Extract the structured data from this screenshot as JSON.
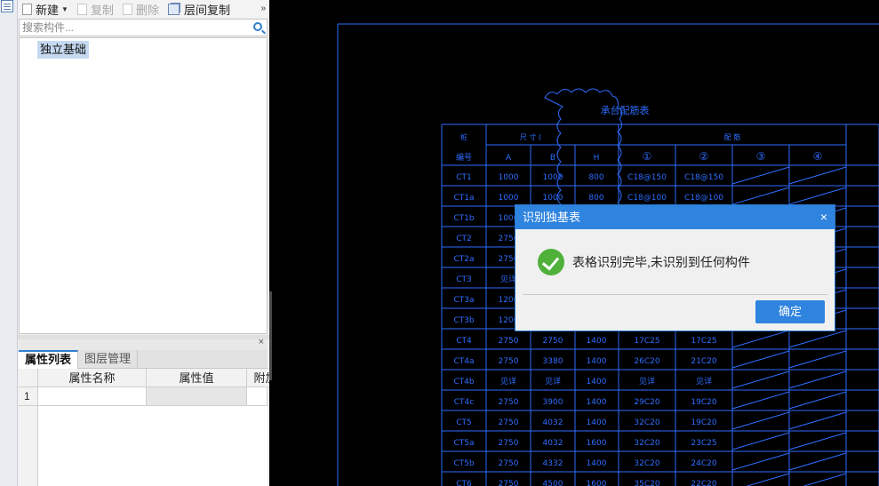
{
  "toolbar": {
    "new_label": "新建",
    "copy_label": "复制",
    "delete_label": "删除",
    "layer_copy_label": "层间复制",
    "more_label": "»"
  },
  "search": {
    "placeholder": "搜索构件..."
  },
  "tree": {
    "selected_item": "独立基础"
  },
  "props_panel": {
    "close_label": "×",
    "tabs": [
      "属性列表",
      "图层管理"
    ],
    "columns": [
      "属性名称",
      "属性值",
      "附加"
    ],
    "rows": [
      "1"
    ]
  },
  "cad": {
    "title": "承台配筋表",
    "header_row1": [
      "桩",
      "尺 寸 (",
      "配 筋"
    ],
    "header_row2": [
      "编号",
      "A",
      "B",
      "H",
      "①",
      "②",
      "③",
      "④"
    ],
    "rows": [
      [
        "CT1",
        "1000",
        "1000",
        "800",
        "C18@150",
        "C18@150"
      ],
      [
        "CT1a",
        "1000",
        "1000",
        "800",
        "C18@100",
        "C18@100"
      ],
      [
        "CT1b",
        "1000",
        "",
        "",
        "",
        ""
      ],
      [
        "CT2",
        "2750",
        "",
        "",
        "",
        ""
      ],
      [
        "CT2a",
        "2750",
        "",
        "",
        "",
        ""
      ],
      [
        "CT3",
        "见详",
        "",
        "",
        "",
        ""
      ],
      [
        "CT3a",
        "1200",
        "",
        "",
        "",
        ""
      ],
      [
        "CT3b",
        "1200",
        "",
        "",
        "",
        ""
      ],
      [
        "CT4",
        "2750",
        "2750",
        "1400",
        "17C25",
        "17C25"
      ],
      [
        "CT4a",
        "2750",
        "3380",
        "1400",
        "26C20",
        "21C20"
      ],
      [
        "CT4b",
        "见详",
        "见详",
        "1400",
        "见详",
        "见详"
      ],
      [
        "CT4c",
        "2750",
        "3900",
        "1400",
        "29C20",
        "19C20"
      ],
      [
        "CT5",
        "2750",
        "4032",
        "1400",
        "32C20",
        "19C20"
      ],
      [
        "CT5a",
        "2750",
        "4032",
        "1600",
        "32C20",
        "23C25"
      ],
      [
        "CT5b",
        "2750",
        "4332",
        "1400",
        "32C20",
        "24C20"
      ],
      [
        "CT6",
        "2750",
        "4500",
        "1600",
        "35C20",
        "22C20"
      ]
    ],
    "line_color": "#2e6dff"
  },
  "dialog": {
    "title": "识别独基表",
    "close_label": "×",
    "message": "表格识别完毕,未识别到任何构件",
    "ok_label": "确定"
  }
}
